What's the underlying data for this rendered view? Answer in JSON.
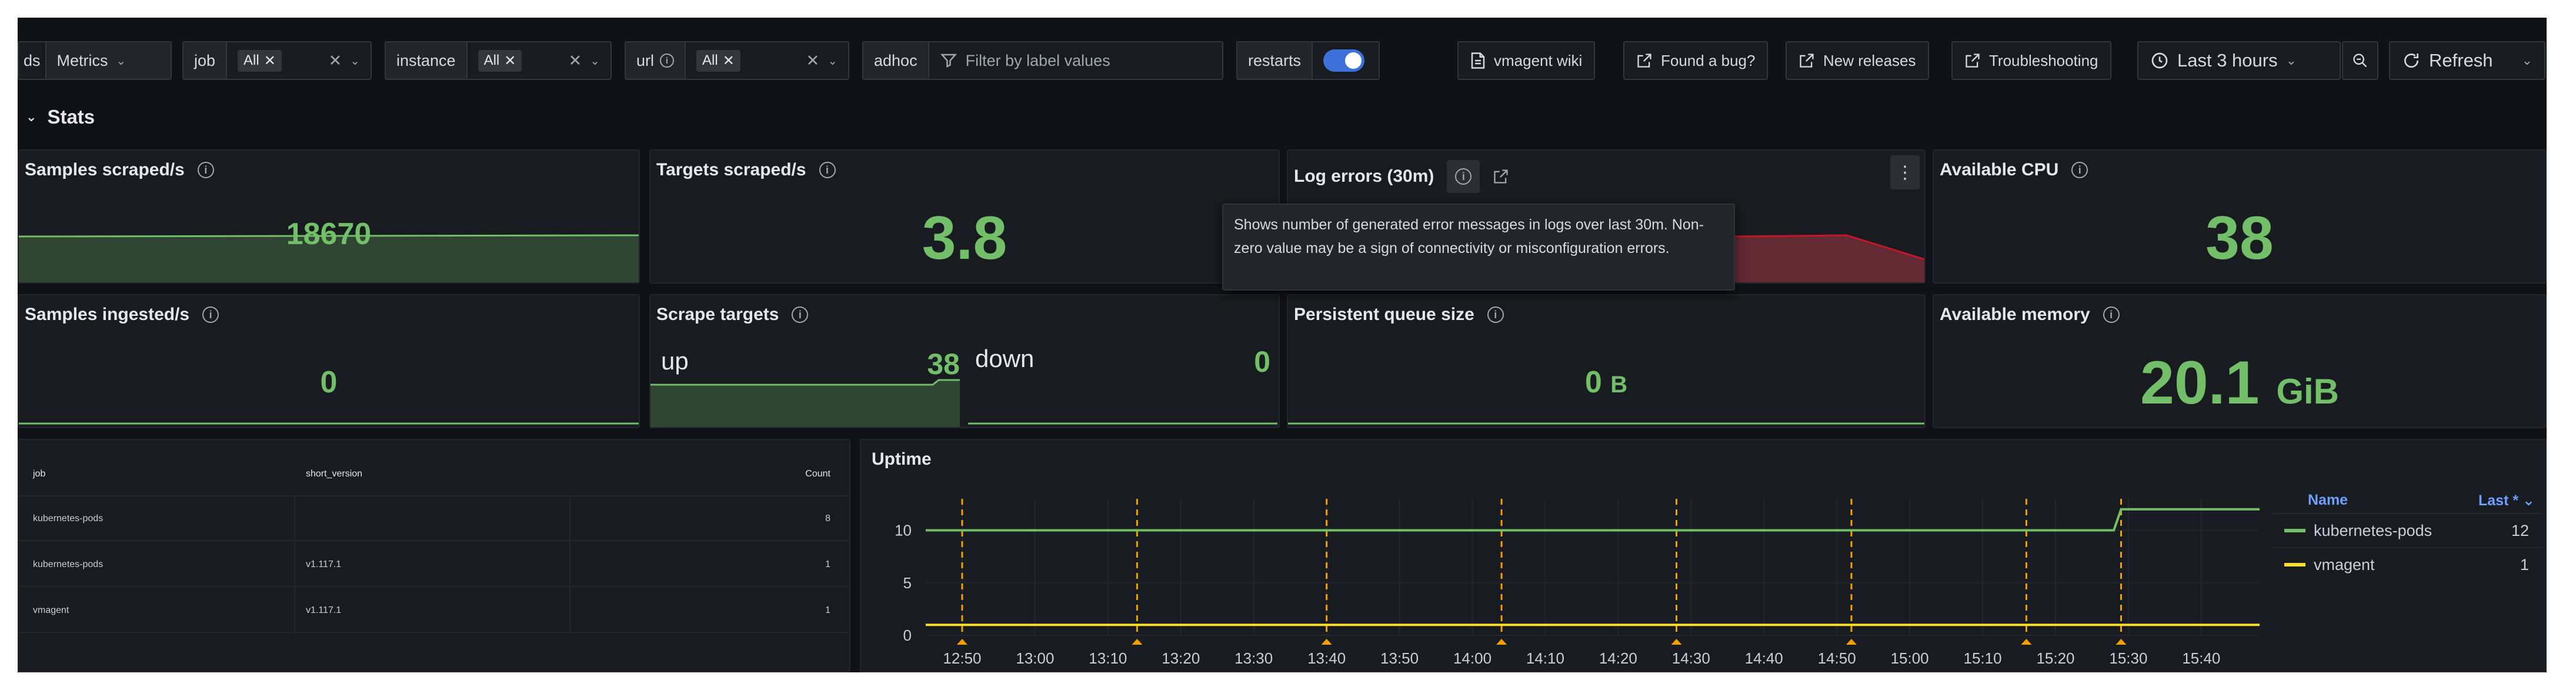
{
  "toolbar": {
    "ds": {
      "label": "ds",
      "value": "Metrics"
    },
    "job": {
      "label": "job",
      "chip": "All"
    },
    "instance": {
      "label": "instance",
      "chip": "All"
    },
    "url": {
      "label": "url",
      "chip": "All"
    },
    "adhoc": {
      "label": "adhoc",
      "placeholder": "Filter by label values"
    },
    "restarts": {
      "label": "restarts",
      "enabled": true
    },
    "links": {
      "wiki": "vmagent wiki",
      "bug": "Found a bug?",
      "releases": "New releases",
      "troubleshooting": "Troubleshooting"
    },
    "time_range": "Last 3 hours",
    "refresh": "Refresh"
  },
  "row": {
    "title": "Stats"
  },
  "panels": {
    "samples_scraped": {
      "title": "Samples scraped/s",
      "value": "18670"
    },
    "targets_scraped": {
      "title": "Targets scraped/s",
      "value": "3.8"
    },
    "log_errors": {
      "title": "Log errors (30m)"
    },
    "available_cpu": {
      "title": "Available CPU",
      "value": "38"
    },
    "samples_ingested": {
      "title": "Samples ingested/s",
      "value": "0"
    },
    "scrape_targets": {
      "title": "Scrape targets",
      "up_label": "up",
      "up_value": "38",
      "down_label": "down",
      "down_value": "0"
    },
    "queue_size": {
      "title": "Persistent queue size",
      "value": "0",
      "unit": "B"
    },
    "available_memory": {
      "title": "Available memory",
      "value": "20.1",
      "unit": "GiB"
    }
  },
  "tooltip": {
    "text": "Shows number of generated error messages in logs over last 30m. Non-zero value may be a sign of connectivity or misconfiguration errors."
  },
  "version_table": {
    "columns": [
      "job",
      "short_version",
      "Count"
    ],
    "rows": [
      [
        "kubernetes-pods",
        "",
        "8"
      ],
      [
        "kubernetes-pods",
        "v1.117.1",
        "1"
      ],
      [
        "vmagent",
        "v1.117.1",
        "1"
      ]
    ]
  },
  "uptime": {
    "title": "Uptime",
    "legend_headers": {
      "name": "Name",
      "last": "Last *"
    },
    "legend": [
      {
        "name": "kubernetes-pods",
        "last": "12",
        "color": "#73bf69"
      },
      {
        "name": "vmagent",
        "last": "1",
        "color": "#fade2a"
      }
    ]
  },
  "chart_data": {
    "type": "line",
    "title": "Uptime",
    "x_ticks": [
      "12:50",
      "13:00",
      "13:10",
      "13:20",
      "13:30",
      "13:40",
      "13:50",
      "14:00",
      "14:10",
      "14:20",
      "14:30",
      "14:40",
      "14:50",
      "15:00",
      "15:10",
      "15:20",
      "15:30",
      "15:40"
    ],
    "y_ticks": [
      0,
      5,
      10
    ],
    "ylim": [
      0,
      13
    ],
    "xlim_minutes_from": "12:45",
    "series": [
      {
        "name": "kubernetes-pods",
        "color": "#73bf69",
        "points": [
          [
            "12:45",
            10
          ],
          [
            "15:28",
            10
          ],
          [
            "15:29",
            12
          ],
          [
            "15:48",
            12
          ]
        ]
      },
      {
        "name": "vmagent",
        "color": "#fade2a",
        "points": [
          [
            "12:45",
            1
          ],
          [
            "15:48",
            1
          ]
        ]
      }
    ],
    "annotations": [
      "12:50",
      "13:14",
      "13:40",
      "14:04",
      "14:28",
      "14:52",
      "15:16",
      "15:29"
    ],
    "annotation_color": "#f2a100",
    "grid": true,
    "legend": "right"
  }
}
